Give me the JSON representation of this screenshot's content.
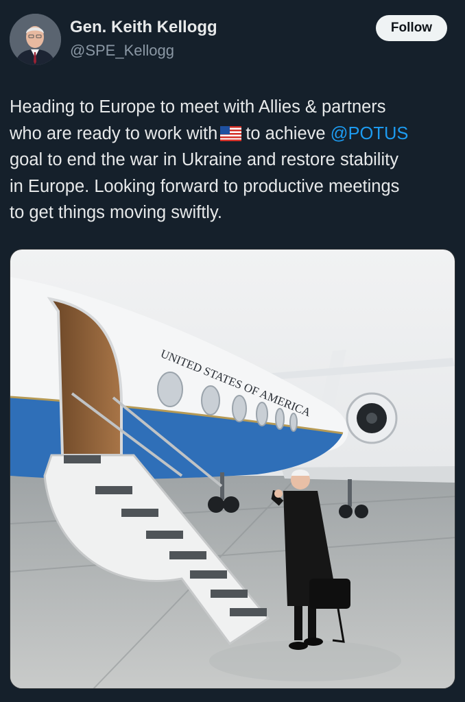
{
  "author": {
    "name": "Gen. Keith Kellogg",
    "handle": "@SPE_Kellogg",
    "avatar_icon": "profile-photo"
  },
  "follow_label": "Follow",
  "tweet": {
    "line1": "Heading to Europe to meet with Allies & partners",
    "line2_before": "who are ready to work with",
    "line2_emoji": "us-flag-emoji",
    "line2_after": "to achieve",
    "mention": "@POTUS",
    "line3": "goal to end the war in Ukraine and restore stability",
    "line4": "in Europe. Looking forward to productive meetings",
    "line5": "to get things moving swiftly."
  },
  "media": {
    "plane_lettering": "UNITED STATES OF AMERICA"
  },
  "colors": {
    "background": "#15202b",
    "text": "#e7e9ea",
    "secondary": "#8b98a5",
    "link": "#1d9bf0",
    "plane_blue": "#2f6fb8"
  }
}
